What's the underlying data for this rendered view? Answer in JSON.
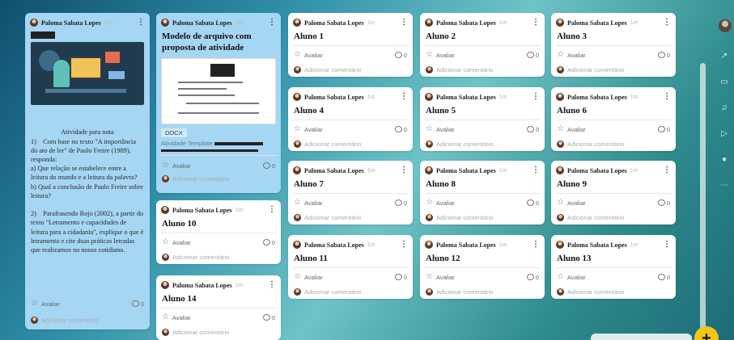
{
  "author": "Paloma Sabata Lopes",
  "time": "1m",
  "actions": {
    "rate_label": "Avaliar",
    "comment_placeholder": "Adicionar comentário",
    "comment_count": "0"
  },
  "activity_card": {
    "heading": "Atividade para nota",
    "text": "1)    Com base no texto \"A importância do ato de ler\" de Paulo Freire (1989), responda:\na) Que relação se estabelece entre a leitura do mundo e a leitura da palavra?\nb) Qual a conclusão de Paulo Freire sobre leitura?\n\n2)    Parafrasendo Rojo (2002), a partir do texto \"Letramento e capacidades de leitura para a cidadania\", explique o que é letramento e cite duas práticas letradas que realizamos no nosso cotidiano."
  },
  "template_card": {
    "title": "Modelo de arquivo com proposta de atividade",
    "doc_type": "DOCX",
    "doc_name": "Atividade Template"
  },
  "student_cards": [
    {
      "title": "Aluno 1"
    },
    {
      "title": "Aluno 2"
    },
    {
      "title": "Aluno 3"
    },
    {
      "title": "Aluno 4"
    },
    {
      "title": "Aluno 5"
    },
    {
      "title": "Aluno 6"
    },
    {
      "title": "Aluno 7"
    },
    {
      "title": "Aluno 8"
    },
    {
      "title": "Aluno 9"
    },
    {
      "title": "Aluno 10"
    },
    {
      "title": "Aluno 11"
    },
    {
      "title": "Aluno 12"
    },
    {
      "title": "Aluno 13"
    },
    {
      "title": "Aluno 14"
    }
  ],
  "rail_icons": [
    "user-avatar",
    "share-icon",
    "slideshow-icon",
    "bell-icon",
    "play-icon",
    "settings-icon",
    "more-icon"
  ],
  "fab_label": "+",
  "colors": {
    "accent": "#f4c516",
    "card_highlight": "#a5d6f4"
  }
}
